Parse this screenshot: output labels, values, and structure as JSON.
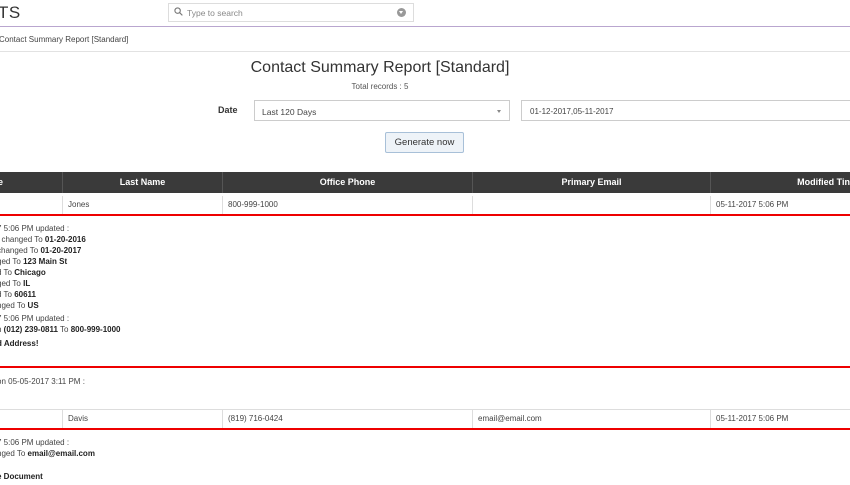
{
  "app": {
    "brand": "TS"
  },
  "search": {
    "placeholder": "Type to search"
  },
  "breadcrumb": "Contact Summary Report [Standard]",
  "report": {
    "title": "Contact Summary Report [Standard]",
    "total_records": "Total records : 5",
    "date_label": "Date",
    "date_filter": "Last 120 Days",
    "date_range": "01-12-2017,05-11-2017",
    "generate_label": "Generate now"
  },
  "table": {
    "headers": [
      "e",
      "Last Name",
      "Office Phone",
      "Primary Email",
      "Modified Tin"
    ],
    "rows": [
      {
        "last_name": "Jones",
        "office_phone": "800-999-1000",
        "primary_email": "",
        "modified": "05-11-2017 5:06 PM"
      },
      {
        "last_name": "Davis",
        "office_phone": "(819) 716-0424",
        "primary_email": "email@email.com",
        "modified": "05-11-2017 5:06 PM"
      }
    ]
  },
  "details": {
    "jones": {
      "line1": "7 5:06 PM updated :",
      "line2_pre": ": changed To ",
      "line2_b": "01-20-2016",
      "line3_pre": " changed To ",
      "line3_b": "01-20-2017",
      "line4_pre": "ged To ",
      "line4_b": "123 Main St",
      "line5_pre": "d To ",
      "line5_b": "Chicago",
      "line6_pre": "ged To ",
      "line6_b": "IL",
      "line7_pre": "d To ",
      "line7_b": "60611",
      "line8_pre": "nged To ",
      "line8_b": "US",
      "line9": "7 5:06 PM updated :",
      "line10_pre": "n ",
      "line10_b1": "(012) 239-0811",
      "line10_mid": " To ",
      "line10_b2": "800-999-1000",
      "line11": "d Address!",
      "line12": "on 05-05-2017 3:11 PM :"
    },
    "davis": {
      "line1": "7 5:06 PM updated :",
      "line2_pre": "nged To ",
      "line2_b": "email@email.com",
      "line3": "e Document"
    }
  }
}
